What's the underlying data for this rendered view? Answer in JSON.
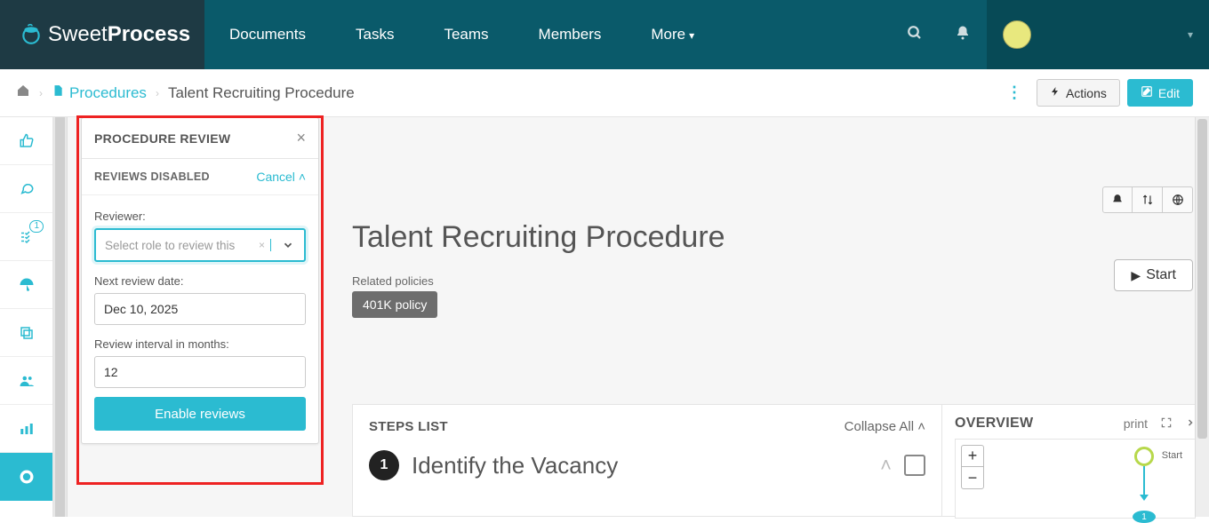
{
  "brand": {
    "name_light": "Sweet",
    "name_bold": "Process"
  },
  "nav": {
    "documents": "Documents",
    "tasks": "Tasks",
    "teams": "Teams",
    "members": "Members",
    "more": "More"
  },
  "breadcrumb": {
    "section": "Procedures",
    "current": "Talent Recruiting Procedure",
    "actions": "Actions",
    "edit": "Edit"
  },
  "rail": {
    "badge": "1"
  },
  "review_panel": {
    "title": "PROCEDURE REVIEW",
    "status": "REVIEWS DISABLED",
    "cancel": "Cancel",
    "reviewer_label": "Reviewer:",
    "reviewer_placeholder": "Select role to review this",
    "next_date_label": "Next review date:",
    "next_date_value": "Dec 10, 2025",
    "interval_label": "Review interval in months:",
    "interval_value": "12",
    "enable": "Enable reviews"
  },
  "doc": {
    "title": "Talent Recruiting Procedure",
    "related_label": "Related policies",
    "related_tag": "401K policy",
    "start": "Start"
  },
  "steps": {
    "header": "STEPS LIST",
    "collapse": "Collapse All",
    "step1_num": "1",
    "step1_title": "Identify the Vacancy"
  },
  "overview": {
    "title": "OVERVIEW",
    "print": "print",
    "start_label": "Start",
    "node1": "1"
  }
}
